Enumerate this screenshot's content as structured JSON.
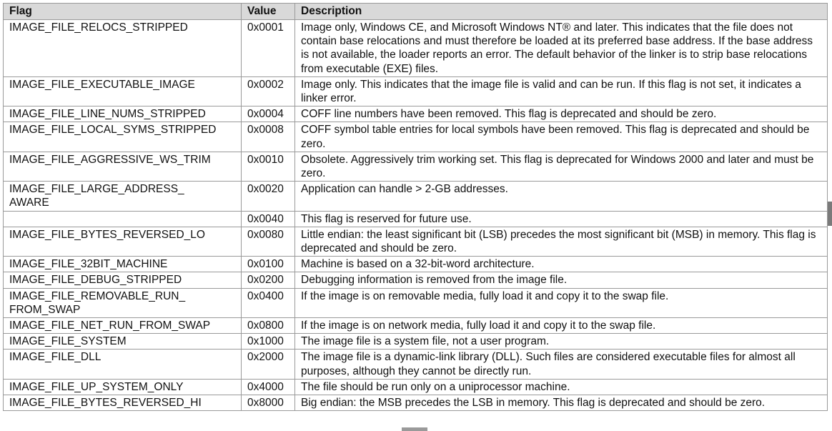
{
  "table": {
    "headers": {
      "flag": "Flag",
      "value": "Value",
      "description": "Description"
    },
    "rows": [
      {
        "flag": "IMAGE_FILE_RELOCS_STRIPPED",
        "value": "0x0001",
        "description": "Image only, Windows CE, and Microsoft Windows NT® and later. This indicates that the file does not contain base relocations and must therefore be loaded at its preferred base address. If the base address is not available, the loader reports an error. The default behavior of the linker is to strip base relocations from executable (EXE) files."
      },
      {
        "flag": "IMAGE_FILE_EXECUTABLE_IMAGE",
        "value": "0x0002",
        "description": "Image only. This indicates that the image file is valid and can be run. If this flag is not set, it indicates a linker error."
      },
      {
        "flag": "IMAGE_FILE_LINE_NUMS_STRIPPED",
        "value": "0x0004",
        "description": "COFF line numbers have been removed. This flag is deprecated and should be zero."
      },
      {
        "flag": "IMAGE_FILE_LOCAL_SYMS_STRIPPED",
        "value": "0x0008",
        "description": "COFF symbol table entries for local symbols have been removed. This flag is deprecated and should be zero."
      },
      {
        "flag": "IMAGE_FILE_AGGRESSIVE_WS_TRIM",
        "value": "0x0010",
        "description": "Obsolete. Aggressively trim working set. This flag is deprecated for Windows 2000 and later and must be zero."
      },
      {
        "flag": "IMAGE_FILE_LARGE_ADDRESS_\nAWARE",
        "value": "0x0020",
        "description": "Application can handle > 2-GB addresses."
      },
      {
        "flag": "",
        "value": "0x0040",
        "description": "This flag is reserved for future use."
      },
      {
        "flag": "IMAGE_FILE_BYTES_REVERSED_LO",
        "value": "0x0080",
        "description": "Little endian: the least significant bit (LSB) precedes the most significant bit (MSB) in memory. This flag is deprecated and should be zero."
      },
      {
        "flag": "IMAGE_FILE_32BIT_MACHINE",
        "value": "0x0100",
        "description": "Machine is based on a 32-bit-word architecture."
      },
      {
        "flag": "IMAGE_FILE_DEBUG_STRIPPED",
        "value": "0x0200",
        "description": "Debugging information is removed from the image file."
      },
      {
        "flag": "IMAGE_FILE_REMOVABLE_RUN_\nFROM_SWAP",
        "value": "0x0400",
        "description": "If the image is on removable media, fully load it and copy it to the swap file."
      },
      {
        "flag": "IMAGE_FILE_NET_RUN_FROM_SWAP",
        "value": "0x0800",
        "description": "If the image is on network media, fully load it and copy it to the swap file."
      },
      {
        "flag": "IMAGE_FILE_SYSTEM",
        "value": "0x1000",
        "description": "The image file is a system file, not a user program."
      },
      {
        "flag": "IMAGE_FILE_DLL",
        "value": "0x2000",
        "description": "The image file is a dynamic-link library (DLL). Such files are considered executable files for almost all purposes, although they cannot be directly run."
      },
      {
        "flag": "IMAGE_FILE_UP_SYSTEM_ONLY",
        "value": "0x4000",
        "description": "The file should be run only on a uniprocessor machine."
      },
      {
        "flag": "IMAGE_FILE_BYTES_REVERSED_HI",
        "value": "0x8000",
        "description": "Big endian: the MSB precedes the LSB in memory. This flag is deprecated and should be zero."
      }
    ]
  }
}
